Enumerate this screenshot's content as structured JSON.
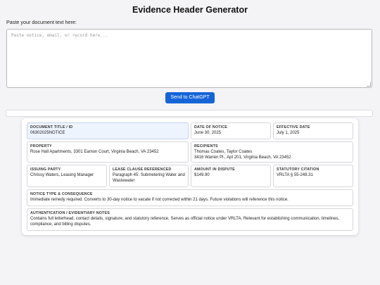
{
  "app": {
    "title": "Evidence Header Generator",
    "prompt_label": "Paste your document text here:",
    "input_placeholder": "Paste notice, email, or record here...",
    "send_label": "Send to ChatGPT"
  },
  "fields": {
    "doc_title": {
      "label": "DOCUMENT TITLE / ID",
      "value": "06302025NOTICE"
    },
    "date_of_notice": {
      "label": "DATE OF NOTICE",
      "value": "June 30, 2025"
    },
    "effective_date": {
      "label": "EFFECTIVE DATE",
      "value": "July 1, 2025"
    },
    "property": {
      "label": "PROPERTY",
      "value": "Rose Hall Apartments, 3301 Eamon Court, Virginia Beach, VA 23452"
    },
    "recipients": {
      "label": "RECIPIENTS",
      "line1": "Thomas Coates, Taylor Coates",
      "line2": "3416 Warren Pl., Apt 201, Virginia Beach, VA 23452"
    },
    "issuing_party": {
      "label": "ISSUING PARTY",
      "value": "Chrissy Waters, Leasing Manager"
    },
    "lease_clause": {
      "label": "LEASE CLAUSE REFERENCED",
      "value": "Paragraph 45: Submetering Water and Wastewater"
    },
    "amount": {
      "label": "AMOUNT IN DISPUTE",
      "value": "$149.90"
    },
    "statutory": {
      "label": "STATUTORY CITATION",
      "value": "VRLTA § 55-248.31"
    },
    "notice_type": {
      "label": "NOTICE TYPE & CONSEQUENCE",
      "value": "Immediate remedy required. Converts to 30-day notice to vacate if not corrected within 21 days. Future violations will reference this notice."
    },
    "authentication": {
      "label": "AUTHENTICATION / EVIDENTIARY NOTES",
      "value": "Contains full letterhead, contact details, signature, and statutory reference. Serves as official notice under VRLTA. Relevant for establishing communication, timelines, compliance, and billing disputes."
    }
  }
}
